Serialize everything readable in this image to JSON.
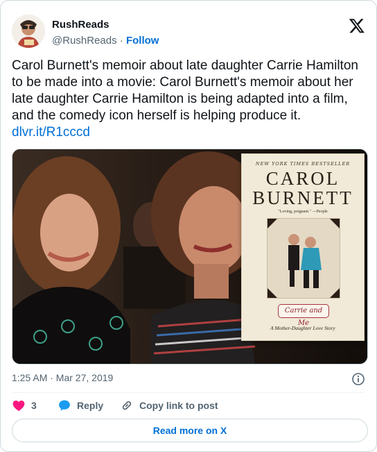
{
  "author": {
    "name": "RushReads",
    "handle": "@RushReads",
    "separator": "·",
    "follow_label": "Follow"
  },
  "post": {
    "text": "Carol Burnett's memoir about late daughter Carrie Hamilton to be made into a movie: Carol Burnett's memoir about her late daughter Carrie Hamilton is being adapted into a film, and the comedy icon herself is helping produce it. ",
    "link_text": "dlvr.it/R1cccd",
    "timestamp": "1:25 AM · Mar 27, 2019"
  },
  "book_cover": {
    "bestseller": "NEW YORK TIMES BESTSELLER",
    "title_line1": "CAROL",
    "title_line2": "BURNETT",
    "quote": "\"Loving, poignant.\" —People",
    "signature_title": "Carrie and Me",
    "subtitle": "A Mother-Daughter Love Story"
  },
  "actions": {
    "likes_count": "3",
    "reply_label": "Reply",
    "copy_label": "Copy link to post"
  },
  "footer": {
    "read_more_label": "Read more on X"
  },
  "colors": {
    "accent": "#006fd6",
    "like": "#f91880",
    "muted": "#536471",
    "border": "#cfd9de"
  },
  "icons": [
    "x-logo-icon",
    "info-icon",
    "heart-icon",
    "reply-icon",
    "link-icon"
  ]
}
